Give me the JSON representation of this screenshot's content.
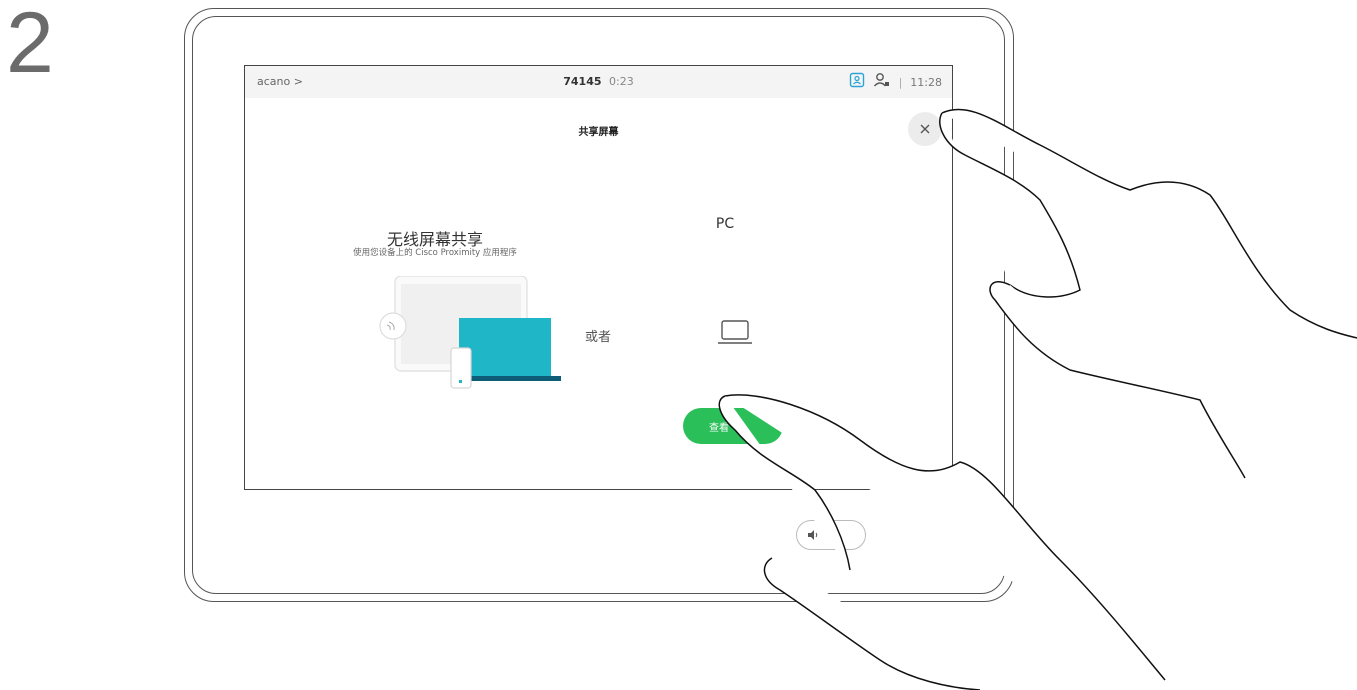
{
  "step": {
    "number": "2"
  },
  "status_bar": {
    "breadcrumb": "acano >",
    "call_number": "74145",
    "call_duration": "0:23",
    "clock": "11:28",
    "separator": "|",
    "icons": [
      "self-view-icon",
      "participants-icon"
    ]
  },
  "panel": {
    "title": "共享屏幕",
    "close_icon": "close-icon"
  },
  "wireless": {
    "heading": "无线屏幕共享",
    "subtitle": "使用您设备上的 Cisco Proximity 应用程序"
  },
  "pc": {
    "heading": "PC",
    "icon": "laptop-icon"
  },
  "or_text": "或者",
  "share_button": {
    "label": "查看"
  },
  "volume": {
    "icon": "volume-icon"
  },
  "colors": {
    "accent_green": "#2bbf5a",
    "accent_teal": "#1fb6c8",
    "status_blue": "#2aa4d8",
    "frame": "#555555"
  }
}
